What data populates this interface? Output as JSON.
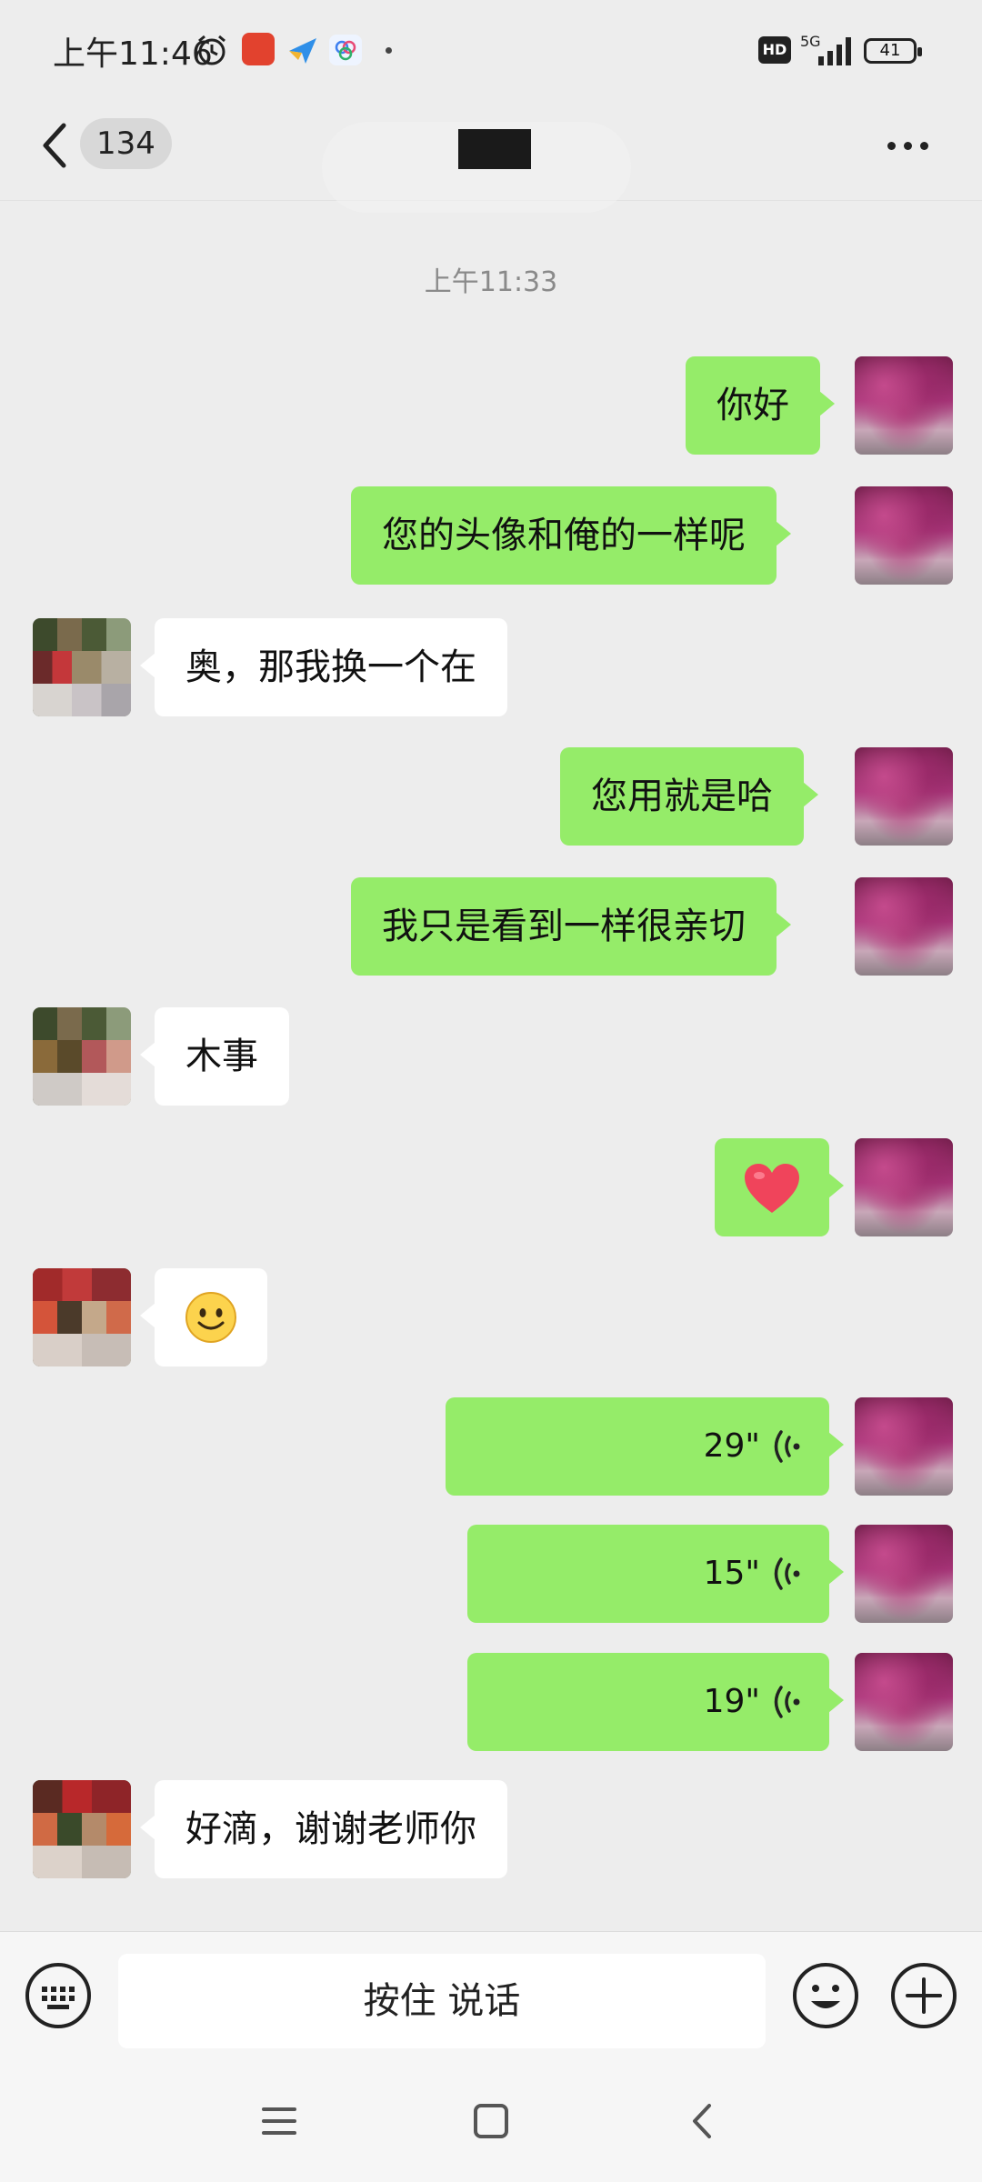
{
  "status_bar": {
    "time": "上午11:46",
    "network": "5G",
    "hd": "HD",
    "battery": "41"
  },
  "header": {
    "unread_count": "134"
  },
  "timestamp": "上午11:33",
  "messages": [
    {
      "from": "me",
      "type": "text",
      "text": "你好"
    },
    {
      "from": "me",
      "type": "text",
      "text": "您的头像和俺的一样呢"
    },
    {
      "from": "them",
      "type": "text",
      "text": "奥，那我换一个在"
    },
    {
      "from": "me",
      "type": "text",
      "text": "您用就是哈"
    },
    {
      "from": "me",
      "type": "text",
      "text": "我只是看到一样很亲切"
    },
    {
      "from": "them",
      "type": "text",
      "text": "木事"
    },
    {
      "from": "me",
      "type": "emoji",
      "emoji": "heart-icon"
    },
    {
      "from": "them",
      "type": "emoji",
      "emoji": "smile-icon"
    },
    {
      "from": "me",
      "type": "voice",
      "duration": "29\""
    },
    {
      "from": "me",
      "type": "voice",
      "duration": "15\""
    },
    {
      "from": "me",
      "type": "voice",
      "duration": "19\""
    },
    {
      "from": "them",
      "type": "text",
      "text": "好滴，谢谢老师你"
    }
  ],
  "composer": {
    "hold_to_talk": "按住 说话"
  },
  "colors": {
    "my_bubble": "#95ec69",
    "their_bubble": "#ffffff",
    "background": "#ededed"
  }
}
